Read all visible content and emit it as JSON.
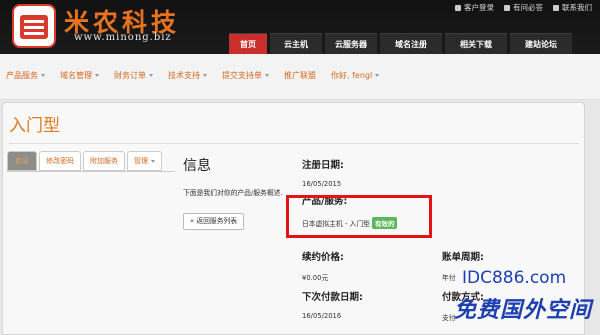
{
  "header": {
    "brand": "米农科技",
    "domain": "www.minong.biz",
    "top_links": [
      {
        "label": "客户登录",
        "icon": "lock-icon"
      },
      {
        "label": "有问必答",
        "icon": "question-icon"
      },
      {
        "label": "联系我们",
        "icon": "contact-icon"
      }
    ],
    "nav": [
      "首页",
      "云主机",
      "云服务器",
      "域名注册",
      "相关下载",
      "建站论坛"
    ]
  },
  "subnav": [
    "产品服务",
    "域名管理",
    "财务订单",
    "技术支持",
    "提交支持单",
    "推广联盟",
    "你好, fengl"
  ],
  "page": {
    "title": "入门型",
    "tabs": [
      "信息",
      "修改密码",
      "附加服务",
      "管理"
    ],
    "info_heading": "信息",
    "info_desc": "下面是我们对你的产品/服务概述.",
    "back_button": "« 返回服务列表"
  },
  "details": {
    "reg_date_label": "注册日期:",
    "reg_date_value": "16/05/2015",
    "product_label": "产品/服务:",
    "product_value": "日本虚拟主机 - 入门型",
    "status": "有效的",
    "price_label": "续约价格:",
    "price_value": "¥0.00元",
    "billing_label": "账单周期:",
    "billing_value": "年付",
    "next_due_label": "下次付款日期:",
    "next_due_value": "16/05/2016",
    "payment_label": "付款方式:",
    "payment_value": "支付"
  },
  "colors": {
    "accent_orange": "#e07a1b",
    "nav_active": "#c9302c",
    "status_green": "#5cb85c",
    "highlight_red": "#e21414",
    "watermark_blue": "#1d3fb0"
  },
  "watermark": {
    "url": "IDC886.com",
    "text": "免费国外空间"
  }
}
